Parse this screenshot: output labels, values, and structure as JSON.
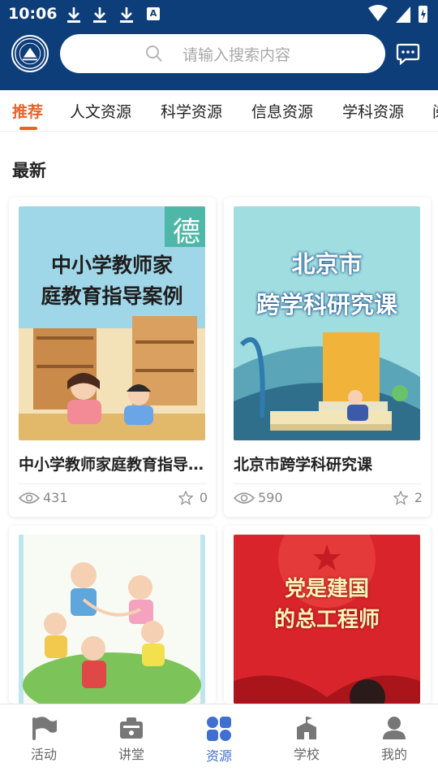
{
  "status_bar": {
    "time": "10:06",
    "a_badge": "A"
  },
  "header": {
    "search_placeholder": "请输入搜索内容"
  },
  "tabs": [
    {
      "label": "推荐",
      "active": true
    },
    {
      "label": "人文资源",
      "active": false
    },
    {
      "label": "科学资源",
      "active": false
    },
    {
      "label": "信息资源",
      "active": false
    },
    {
      "label": "学科资源",
      "active": false
    },
    {
      "label": "阅",
      "active": false
    }
  ],
  "section": {
    "title": "最新"
  },
  "cards": [
    {
      "title": "中小学教师家庭教育指导案例",
      "views": "431",
      "favorites": "0",
      "cover": {
        "badge": "德",
        "lines": [
          "中小学教师家",
          "庭教育指导案例"
        ]
      }
    },
    {
      "title": "北京市跨学科研究课",
      "views": "590",
      "favorites": "2",
      "cover": {
        "lines": [
          "北京市",
          "跨学科研究课"
        ]
      }
    },
    {
      "title": "",
      "views": "",
      "favorites": "",
      "cover": {
        "lines": []
      }
    },
    {
      "title": "",
      "views": "",
      "favorites": "",
      "cover": {
        "lines": [
          "党是建国",
          "的总工程师"
        ]
      }
    }
  ],
  "bottom_nav": [
    {
      "label": "活动",
      "icon": "flag-icon",
      "active": false
    },
    {
      "label": "讲堂",
      "icon": "lectern-icon",
      "active": false
    },
    {
      "label": "资源",
      "icon": "grid-icon",
      "active": true
    },
    {
      "label": "学校",
      "icon": "school-icon",
      "active": false
    },
    {
      "label": "我的",
      "icon": "user-icon",
      "active": false
    }
  ],
  "colors": {
    "header_bg": "#0e3e7a",
    "accent": "#e8632a",
    "nav_active": "#3f6fd0"
  }
}
